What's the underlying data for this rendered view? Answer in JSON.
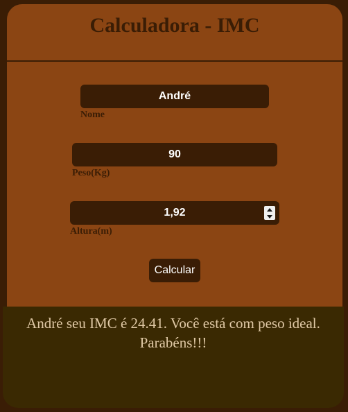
{
  "header": {
    "title": "Calculadora - IMC"
  },
  "form": {
    "nome": {
      "value": "André",
      "label": "Nome"
    },
    "peso": {
      "value": "90",
      "label": "Peso(Kg)"
    },
    "altura": {
      "value": "1,92",
      "label": "Altura(m)"
    },
    "submit_label": "Calcular"
  },
  "result": {
    "message": "André seu IMC é 24.41. Você está com peso ideal. Parabéns!!!"
  },
  "icons": {
    "spinner": "number-spinner-icon"
  },
  "colors": {
    "page_background": "#3a1d05",
    "card_background": "#8b4513",
    "input_background": "#3a1d05",
    "result_background": "#3a2902",
    "result_text": "#e0c9a6"
  }
}
